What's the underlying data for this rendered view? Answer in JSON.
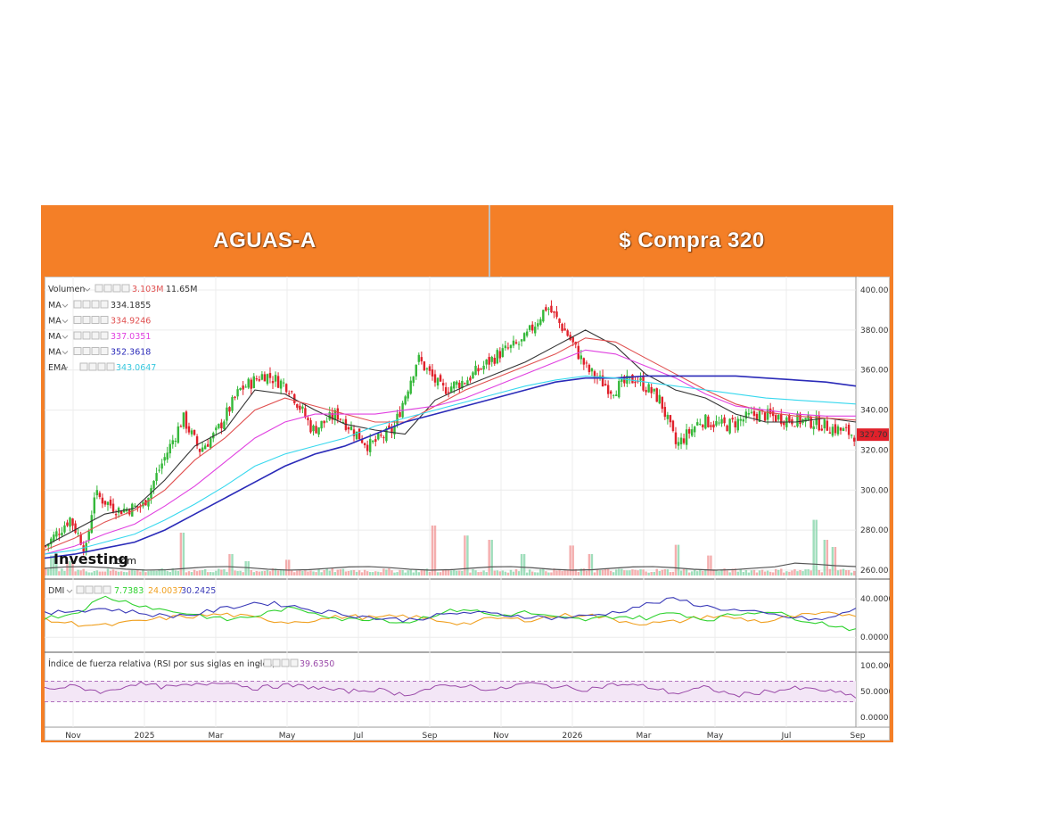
{
  "header": {
    "ticker": "AGUAS-A",
    "signal": "$ Compra 320"
  },
  "colors": {
    "header_bg": "#f47f27",
    "candle_up": "#35b83a",
    "candle_down": "#e0212b",
    "ma1": "#333333",
    "ma2": "#e05050",
    "ma3": "#e040e0",
    "ma4": "#2a2ab8",
    "ema": "#38d8ee",
    "dmi_plus": "#2fd22f",
    "dmi_minus": "#f0a020",
    "adx": "#3a3ab8",
    "rsi": "#9a4aa8"
  },
  "chart_data": {
    "type": "candlestick",
    "brand": "Investing",
    "brand_suffix": ".com",
    "last_price_label": "327.70",
    "price_axis": {
      "min": 260,
      "max": 400,
      "ticks": [
        "400.00",
        "380.00",
        "360.00",
        "340.00",
        "320.00",
        "300.00",
        "280.00",
        "260.00"
      ]
    },
    "x_ticks": [
      "Nov",
      "2025",
      "Mar",
      "May",
      "Jul",
      "Sep",
      "Nov",
      "2026",
      "Mar",
      "May",
      "Jul",
      "Sep"
    ],
    "price_path": [
      {
        "x": 0,
        "close": 272
      },
      {
        "x": 0.03,
        "close": 286
      },
      {
        "x": 0.05,
        "close": 270
      },
      {
        "x": 0.06,
        "close": 298
      },
      {
        "x": 0.09,
        "close": 290
      },
      {
        "x": 0.12,
        "close": 292
      },
      {
        "x": 0.14,
        "close": 310
      },
      {
        "x": 0.17,
        "close": 336
      },
      {
        "x": 0.19,
        "close": 320
      },
      {
        "x": 0.21,
        "close": 328
      },
      {
        "x": 0.24,
        "close": 350
      },
      {
        "x": 0.27,
        "close": 358
      },
      {
        "x": 0.3,
        "close": 352
      },
      {
        "x": 0.33,
        "close": 330
      },
      {
        "x": 0.36,
        "close": 338
      },
      {
        "x": 0.4,
        "close": 322
      },
      {
        "x": 0.43,
        "close": 330
      },
      {
        "x": 0.46,
        "close": 366
      },
      {
        "x": 0.49,
        "close": 350
      },
      {
        "x": 0.52,
        "close": 355
      },
      {
        "x": 0.56,
        "close": 368
      },
      {
        "x": 0.59,
        "close": 374
      },
      {
        "x": 0.62,
        "close": 392
      },
      {
        "x": 0.645,
        "close": 378
      },
      {
        "x": 0.67,
        "close": 360
      },
      {
        "x": 0.7,
        "close": 350
      },
      {
        "x": 0.73,
        "close": 356
      },
      {
        "x": 0.76,
        "close": 345
      },
      {
        "x": 0.78,
        "close": 322
      },
      {
        "x": 0.81,
        "close": 335
      },
      {
        "x": 0.84,
        "close": 332
      },
      {
        "x": 0.88,
        "close": 338
      },
      {
        "x": 0.91,
        "close": 336
      },
      {
        "x": 0.95,
        "close": 334
      },
      {
        "x": 1.0,
        "close": 327.7
      }
    ],
    "volume": {
      "label": "Volumen",
      "value": "3.103M",
      "avg": "11.65M",
      "spikes": [
        {
          "x": 0.01,
          "height": 0.28
        },
        {
          "x": 0.03,
          "height": 0.2
        },
        {
          "x": 0.17,
          "height": 0.6
        },
        {
          "x": 0.23,
          "height": 0.3
        },
        {
          "x": 0.25,
          "height": 0.2
        },
        {
          "x": 0.3,
          "height": 0.22
        },
        {
          "x": 0.48,
          "height": 0.7
        },
        {
          "x": 0.52,
          "height": 0.56
        },
        {
          "x": 0.55,
          "height": 0.5
        },
        {
          "x": 0.59,
          "height": 0.3
        },
        {
          "x": 0.65,
          "height": 0.42
        },
        {
          "x": 0.675,
          "height": 0.3
        },
        {
          "x": 0.78,
          "height": 0.43
        },
        {
          "x": 0.82,
          "height": 0.28
        },
        {
          "x": 0.95,
          "height": 0.78
        },
        {
          "x": 0.965,
          "height": 0.5
        },
        {
          "x": 0.975,
          "height": 0.4
        }
      ]
    },
    "series": [
      {
        "name": "MA",
        "value": "334.1855",
        "color": "#333333",
        "path": [
          272,
          280,
          288,
          291,
          305,
          322,
          330,
          350,
          348,
          340,
          333,
          330,
          328,
          345,
          352,
          358,
          364,
          372,
          380,
          372,
          358,
          350,
          346,
          338,
          334,
          334,
          336,
          334
        ]
      },
      {
        "name": "MA",
        "value": "334.9246",
        "color": "#e05050",
        "path": [
          270,
          276,
          284,
          290,
          300,
          315,
          326,
          340,
          346,
          342,
          338,
          334,
          334,
          342,
          350,
          356,
          362,
          368,
          376,
          374,
          366,
          358,
          350,
          343,
          339,
          337,
          336,
          335
        ]
      },
      {
        "name": "MA",
        "value": "337.0351",
        "color": "#e040e0",
        "path": [
          268,
          272,
          278,
          283,
          292,
          302,
          314,
          326,
          334,
          338,
          338,
          338,
          340,
          342,
          346,
          352,
          358,
          364,
          370,
          368,
          362,
          356,
          348,
          342,
          340,
          338,
          337,
          337
        ]
      },
      {
        "name": "MA",
        "value": "352.3618",
        "color": "#2a2ab8",
        "path": [
          266,
          268,
          271,
          274,
          280,
          288,
          296,
          304,
          312,
          318,
          322,
          328,
          334,
          338,
          342,
          346,
          350,
          354,
          356,
          356,
          357,
          357,
          357,
          357,
          356,
          355,
          354,
          352
        ]
      },
      {
        "name": "EMA",
        "value": "343.0647",
        "color": "#38d8ee",
        "path": [
          268,
          270,
          274,
          278,
          285,
          293,
          302,
          312,
          318,
          322,
          326,
          332,
          336,
          340,
          344,
          348,
          352,
          355,
          357,
          356,
          354,
          352,
          350,
          348,
          346,
          345,
          344,
          343
        ]
      }
    ],
    "dmi": {
      "label": "DMI",
      "values": [
        "7.7383",
        "24.0037",
        "30.2425"
      ],
      "axis_ticks": [
        "40.0000",
        "0.0000"
      ],
      "range": [
        -10,
        55
      ],
      "plus_di": [
        20,
        25,
        42,
        35,
        28,
        24,
        18,
        22,
        30,
        26,
        18,
        20,
        15,
        24,
        30,
        22,
        26,
        20,
        18,
        22,
        20,
        26,
        18,
        24,
        28,
        20,
        14,
        8
      ],
      "minus_di": [
        18,
        14,
        12,
        16,
        20,
        22,
        24,
        20,
        16,
        18,
        22,
        20,
        22,
        18,
        14,
        20,
        18,
        22,
        24,
        18,
        14,
        16,
        22,
        20,
        16,
        22,
        24,
        24
      ],
      "adx": [
        24,
        28,
        30,
        26,
        22,
        24,
        30,
        36,
        34,
        28,
        24,
        20,
        18,
        22,
        26,
        24,
        22,
        20,
        22,
        26,
        34,
        40,
        32,
        28,
        24,
        20,
        18,
        30
      ]
    },
    "rsi": {
      "label": "Índice de fuerza relativa (RSI por sus siglas en inglés)",
      "value": "39.6350",
      "axis_ticks": [
        "100.0000",
        "50.0000",
        "0.0000"
      ],
      "range": [
        0,
        100
      ],
      "band": [
        30,
        70
      ],
      "values": [
        55,
        60,
        48,
        66,
        58,
        62,
        70,
        56,
        62,
        58,
        50,
        54,
        44,
        58,
        62,
        52,
        66,
        60,
        54,
        64,
        60,
        46,
        58,
        42,
        50,
        56,
        52,
        40
      ]
    }
  }
}
